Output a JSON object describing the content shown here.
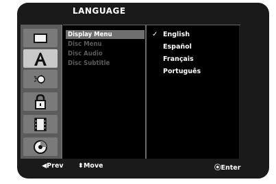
{
  "header": {
    "title": "LANGUAGE"
  },
  "sidebar": {
    "items": [
      {
        "icon": "tv-icon",
        "active": false
      },
      {
        "icon": "language-a-icon",
        "active": true
      },
      {
        "icon": "audio-speaker-icon",
        "active": false
      },
      {
        "icon": "lock-icon",
        "active": false
      },
      {
        "icon": "film-icon",
        "active": false
      },
      {
        "icon": "disc-icon",
        "active": false
      }
    ]
  },
  "menu": {
    "items": [
      {
        "label": "Display Menu",
        "selected": true
      },
      {
        "label": "Disc Menu",
        "selected": false
      },
      {
        "label": "Disc Audio",
        "selected": false
      },
      {
        "label": "Disc Subtitle",
        "selected": false
      }
    ]
  },
  "options": {
    "items": [
      {
        "label": "English",
        "checked": true
      },
      {
        "label": "Español",
        "checked": false
      },
      {
        "label": "Français",
        "checked": false
      },
      {
        "label": "Português",
        "checked": false
      }
    ]
  },
  "footer": {
    "prev": "◀Prev",
    "move": "⬍Move",
    "enter": "⦿Enter"
  },
  "colors": {
    "background": "#1a1a1a",
    "selected_row": "#6f6f6f",
    "disabled_text": "#5a5a5a",
    "text": "#ffffff"
  }
}
